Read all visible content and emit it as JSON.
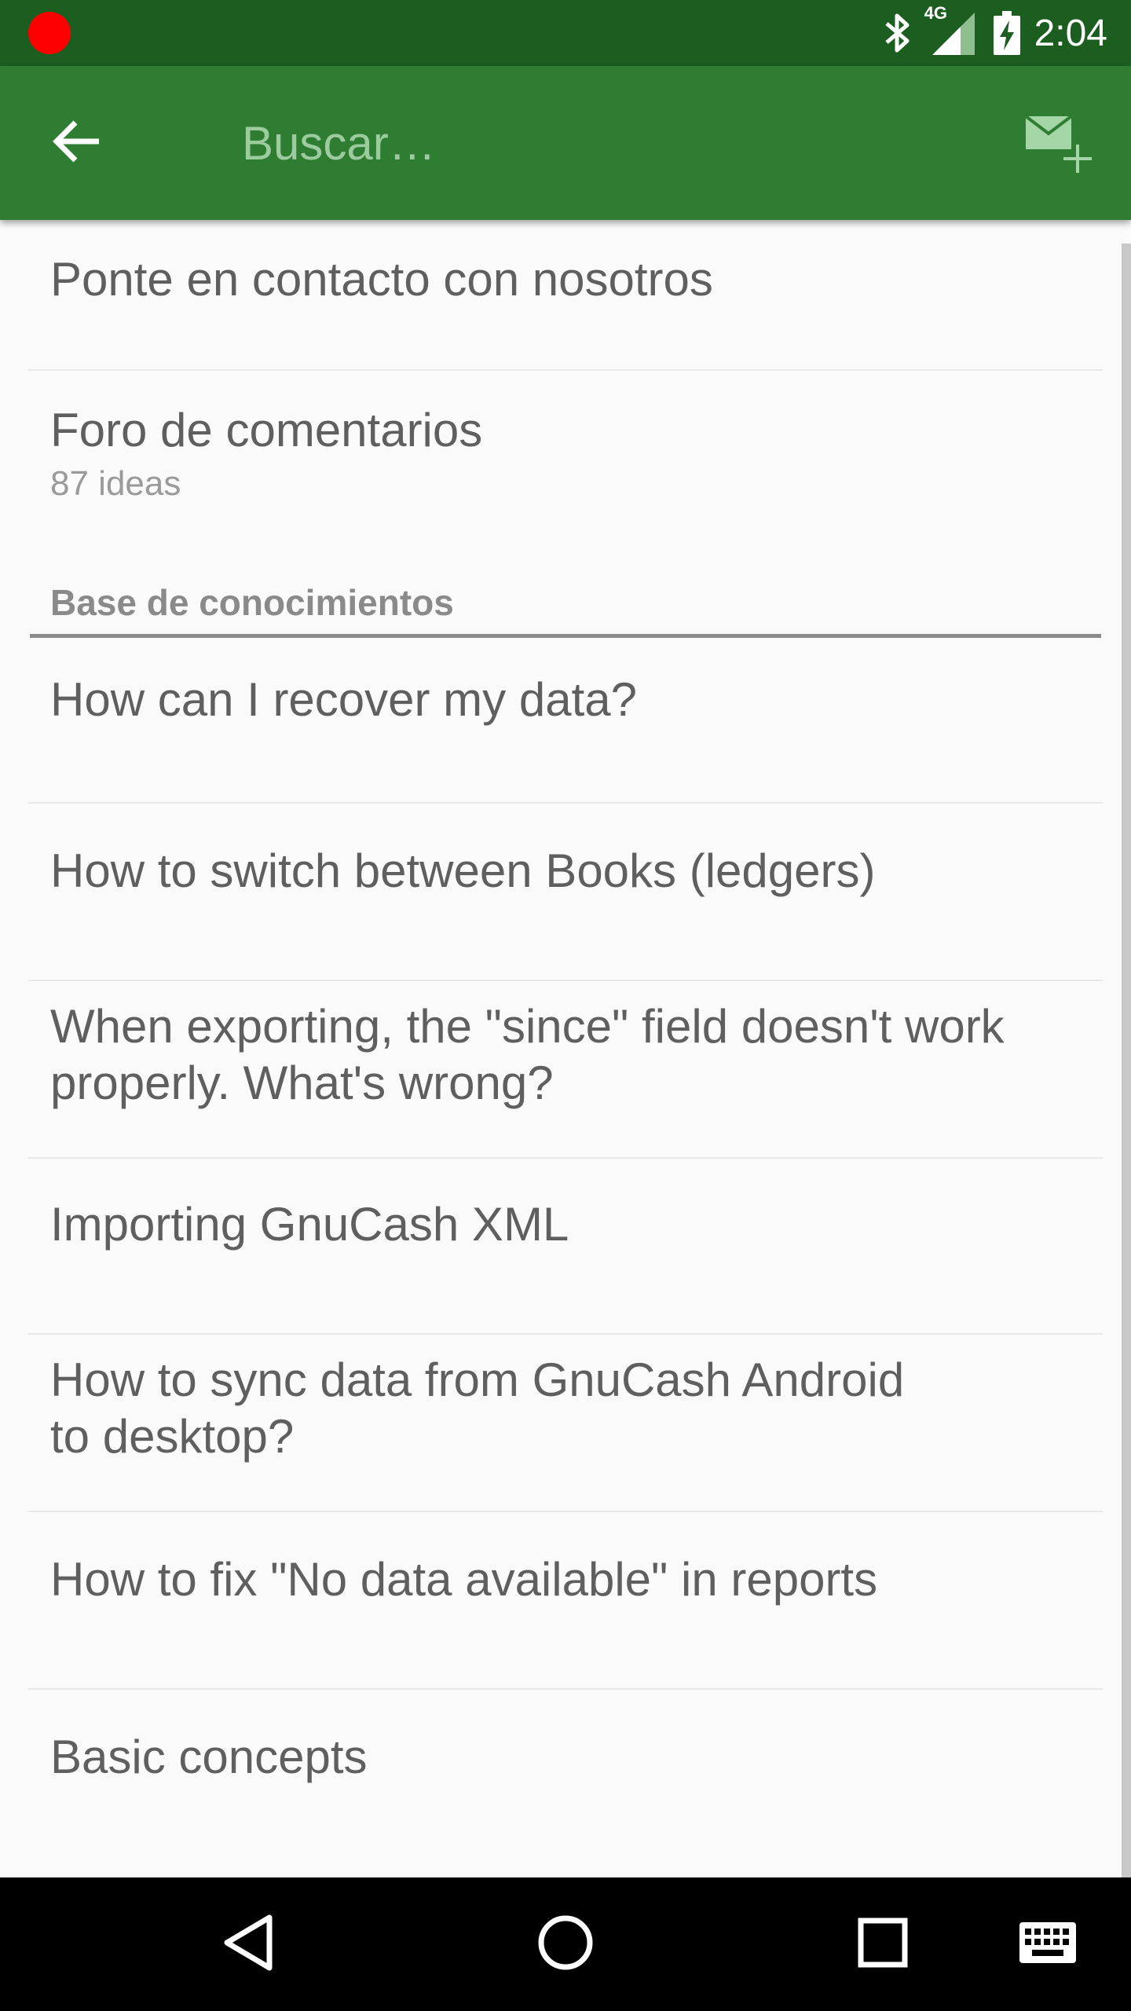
{
  "status_bar": {
    "time": "2:04",
    "network_label": "4G",
    "icons": [
      "recording-dot-icon",
      "bluetooth-icon",
      "cell-signal-icon",
      "battery-charging-icon"
    ]
  },
  "app_bar": {
    "search_placeholder": "Buscar…",
    "search_value": "",
    "icons": [
      "back-arrow-icon",
      "new-message-icon"
    ]
  },
  "main": {
    "contact_label": "Ponte en contacto con nosotros",
    "forum": {
      "title": "Foro de comentarios",
      "subtitle": "87 ideas"
    },
    "knowledge_base": {
      "header": "Base de conocimientos",
      "articles": [
        [
          "How can I recover my data?"
        ],
        [
          "How to switch between Books (ledgers)"
        ],
        [
          "When exporting, the \"since\" field doesn't work",
          "properly. What's wrong?"
        ],
        [
          "Importing GnuCash XML"
        ],
        [
          "How to sync data from GnuCash Android",
          "to desktop?"
        ],
        [
          "How to fix \"No data available\" in reports"
        ],
        [
          "Basic concepts"
        ]
      ]
    }
  },
  "nav_bar": {
    "icons": [
      "back-triangle-icon",
      "home-circle-icon",
      "recents-square-icon",
      "keyboard-icon"
    ]
  },
  "colors": {
    "status_bar": "#1b5e20",
    "app_bar": "#2e7d32",
    "background": "#fafafa",
    "primary_text": "#5f5f5f",
    "secondary_text": "#9a9a9a",
    "nav_bar": "#000000"
  }
}
